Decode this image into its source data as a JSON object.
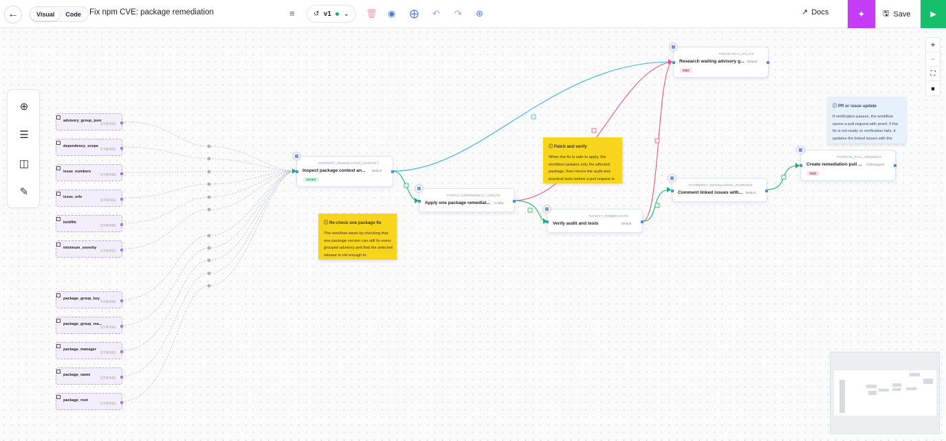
{
  "header": {
    "back_icon": "arrow-left-icon",
    "mode_visual": "Visual",
    "mode_code": "Code",
    "title": "Fix npm CVE: package remediation",
    "version_label": "v1",
    "docs_label": "Docs",
    "save_label": "Save"
  },
  "inputs": [
    {
      "name": "advisory_group_json",
      "type": "STRING"
    },
    {
      "name": "dependency_scope",
      "type": "STRING"
    },
    {
      "name": "issue_numbers",
      "type": "STRING"
    },
    {
      "name": "issue_urls",
      "type": "STRING"
    },
    {
      "name": "lockfile",
      "type": "STRING"
    },
    {
      "name": "minimum_severity",
      "type": "STRING"
    },
    {
      "name": "package_group_key",
      "type": "STRING"
    },
    {
      "name": "package_group_ma...",
      "type": "STRING"
    },
    {
      "name": "package_manager",
      "type": "STRING"
    },
    {
      "name": "package_name",
      "type": "STRING"
    },
    {
      "name": "package_root",
      "type": "STRING"
    }
  ],
  "nodes": {
    "inspect": {
      "id": "#INSPECT_REMEDIATION_CONTEXT",
      "title": "Inspect package context an...",
      "branch": "Default",
      "tag": "START"
    },
    "apply": {
      "id": "#APPLY_DEPENDENCY_UPDATE",
      "title": "Apply one package remediat...",
      "branch": "Config"
    },
    "verify": {
      "id": "#VERIFY_REMEDIATION",
      "title": "Verify audit and tests",
      "branch": "Default"
    },
    "research": {
      "id": "#RESEARCH_NO_FIX",
      "title": "Research waiting advisory g...",
      "branch": "Default",
      "tag": "END"
    },
    "comment": {
      "id": "#COMMENT_REMEDIATION_EVIDENCE",
      "title": "Comment linked issues with...",
      "branch": "Default"
    },
    "create_pr": {
      "id": "#CREATE_PULL_REQUEST",
      "title": "Create remediation pull ...",
      "branch": "Pull Request",
      "tag": "END"
    }
  },
  "notes": {
    "recheck": {
      "title": "Re-check one package fix",
      "body": "The workflow starts by checking that one package version can still fix every grouped advisory and that the selected release is old enough to"
    },
    "patch": {
      "title": "Patch and verify",
      "body": "When the fix is safe to apply, the workflow updates only the affected package, then reruns the audit and practical tests before a pull request is"
    },
    "pr": {
      "title": "PR or issue update",
      "body": "If verification passes, the workflow opens a pull request with proof. If the fix is not ready or verification fails, it updates the linked issues with the"
    }
  },
  "colors": {
    "accent": "#c43cf5",
    "run": "#15bf6b",
    "wire_success": "#19b36b",
    "wire_default": "#36b1dc",
    "wire_fail": "#e5567b"
  }
}
